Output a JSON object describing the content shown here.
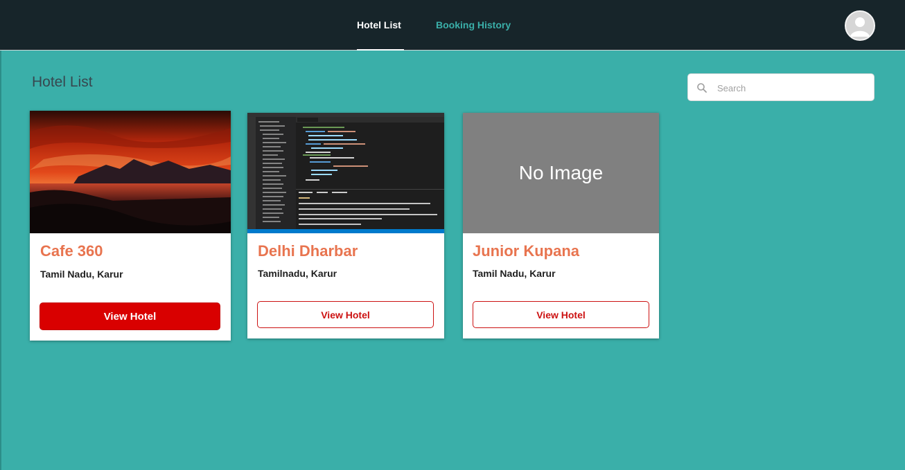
{
  "nav": {
    "tabs": [
      {
        "label": "Hotel List",
        "active": true
      },
      {
        "label": "Booking History",
        "active": false
      }
    ],
    "avatar_icon": "user-avatar-icon"
  },
  "page": {
    "title": "Hotel List"
  },
  "search": {
    "placeholder": "Search",
    "value": "",
    "icon": "search-icon"
  },
  "hotels": [
    {
      "name": "Cafe 360",
      "location": "Tamil Nadu, Karur",
      "button": "View Hotel",
      "image": "sunset-lake-photo"
    },
    {
      "name": "Delhi Dharbar",
      "location": "Tamilnadu, Karur",
      "button": "View Hotel",
      "image": "code-editor-screenshot"
    },
    {
      "name": "Junior Kupana",
      "location": "Tamil Nadu, Karur",
      "button": "View Hotel",
      "image_text": "No Image"
    }
  ],
  "colors": {
    "background": "#3aafa9",
    "topbar": "#17252a",
    "hotel_name": "#e8744f",
    "button_red": "#d90000"
  }
}
